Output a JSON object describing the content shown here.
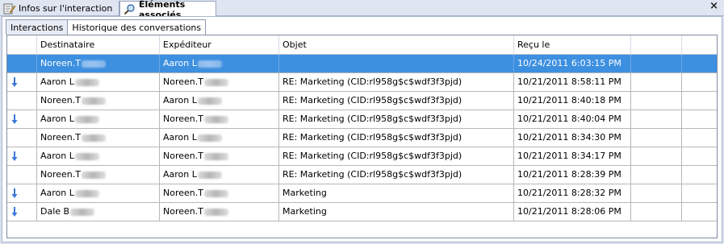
{
  "top_tabs": [
    {
      "label": "Infos sur l'interaction",
      "icon": "edit-document-icon"
    },
    {
      "label": "Éléments associés",
      "icon": "magnifier-icon"
    }
  ],
  "close_label": "×",
  "sub_tabs": [
    {
      "label": "Interactions",
      "active": false
    },
    {
      "label": "Historique des conversations",
      "active": true
    }
  ],
  "columns": [
    "",
    "Destinataire",
    "Expéditeur",
    "Objet",
    "Reçu le"
  ],
  "rows": [
    {
      "direction": "none",
      "selected": true,
      "destinataire": "Noreen.T",
      "expediteur": "Aaron L",
      "objet": "",
      "recu": "10/24/2011 6:03:15 PM"
    },
    {
      "direction": "incoming",
      "selected": false,
      "destinataire": "Aaron L",
      "expediteur": "Noreen.T",
      "objet": "RE: Marketing (CID:rl958g$c$wdf3f3pjd)",
      "recu": "10/21/2011 8:58:11 PM"
    },
    {
      "direction": "none",
      "selected": false,
      "destinataire": "Noreen.T",
      "expediteur": "Aaron L",
      "objet": "RE: Marketing (CID:rl958g$c$wdf3f3pjd)",
      "recu": "10/21/2011 8:40:18 PM"
    },
    {
      "direction": "incoming",
      "selected": false,
      "destinataire": "Aaron L",
      "expediteur": "Noreen.T",
      "objet": "RE: Marketing (CID:rl958g$c$wdf3f3pjd)",
      "recu": "10/21/2011 8:40:04 PM"
    },
    {
      "direction": "none",
      "selected": false,
      "destinataire": "Noreen.T",
      "expediteur": "Aaron L",
      "objet": "RE: Marketing (CID:rl958g$c$wdf3f3pjd)",
      "recu": "10/21/2011 8:34:30 PM"
    },
    {
      "direction": "incoming",
      "selected": false,
      "destinataire": "Aaron L",
      "expediteur": "Noreen.T",
      "objet": "RE: Marketing (CID:rl958g$c$wdf3f3pjd)",
      "recu": "10/21/2011 8:34:17 PM"
    },
    {
      "direction": "none",
      "selected": false,
      "destinataire": "Noreen.T",
      "expediteur": "Aaron L",
      "objet": "RE: Marketing (CID:rl958g$c$wdf3f3pjd)",
      "recu": "10/21/2011 8:28:39 PM"
    },
    {
      "direction": "incoming",
      "selected": false,
      "destinataire": "Aaron L",
      "expediteur": "Noreen.T",
      "objet": "Marketing",
      "recu": "10/21/2011 8:28:32 PM"
    },
    {
      "direction": "incoming",
      "selected": false,
      "destinataire": "Dale B",
      "expediteur": "Noreen.T",
      "objet": "Marketing",
      "recu": "10/21/2011 8:28:06 PM"
    }
  ],
  "colors": {
    "selection": "#3d8fe0",
    "arrow": "#3a78d8"
  }
}
